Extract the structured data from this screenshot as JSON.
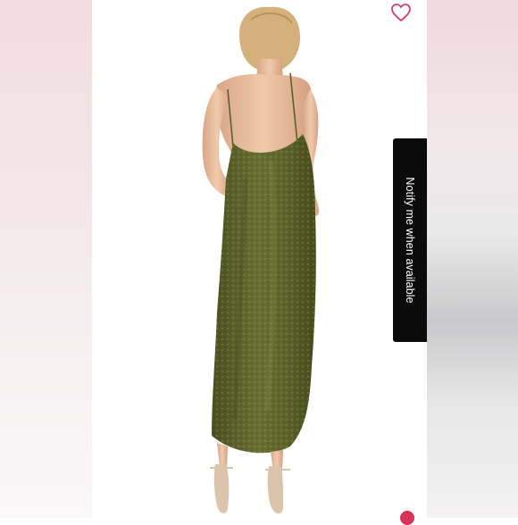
{
  "product_photo": {
    "alt": "",
    "colors": {
      "dress": "#5b6128",
      "dress_highlight": "#8a8a42",
      "skin": "#e5b99a",
      "hair": "#d8b47a",
      "heels": "#dcc4ac"
    }
  },
  "actions": {
    "like_icon": "heart-outline",
    "like_color": "#d23f6b",
    "notify_label": "Notify me when available"
  }
}
